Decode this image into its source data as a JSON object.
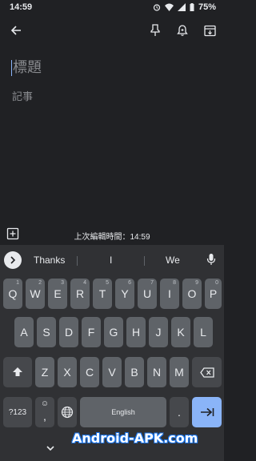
{
  "status_bar": {
    "time": "14:59",
    "battery": "75%"
  },
  "icons": {
    "back": "back-arrow-icon",
    "pin": "pin-icon",
    "reminder": "reminder-bell-icon",
    "archive": "archive-icon",
    "add_box": "add-box-icon",
    "expand": "chevron-right-icon",
    "mic": "mic-icon",
    "shift": "shift-icon",
    "backspace": "backspace-icon",
    "globe": "globe-icon",
    "enter": "enter-arrow-icon"
  },
  "note": {
    "title_placeholder": "標題",
    "body_placeholder": "記事",
    "edited_label": "上次編輯時間：14:59"
  },
  "keyboard": {
    "suggestions": [
      "Thanks",
      "I",
      "We"
    ],
    "row1": [
      {
        "label": "Q",
        "hint": "1"
      },
      {
        "label": "W",
        "hint": "2"
      },
      {
        "label": "E",
        "hint": "3"
      },
      {
        "label": "R",
        "hint": "4"
      },
      {
        "label": "T",
        "hint": "5"
      },
      {
        "label": "Y",
        "hint": "6"
      },
      {
        "label": "U",
        "hint": "7"
      },
      {
        "label": "I",
        "hint": "8"
      },
      {
        "label": "O",
        "hint": "9"
      },
      {
        "label": "P",
        "hint": "0"
      }
    ],
    "row2": [
      "A",
      "S",
      "D",
      "F",
      "G",
      "H",
      "J",
      "K",
      "L"
    ],
    "row3": [
      "Z",
      "X",
      "C",
      "V",
      "B",
      "N",
      "M"
    ],
    "symbols_label": "?123",
    "emoji_label": "☺",
    "comma_label": ",",
    "space_label": "English",
    "period_label": "."
  },
  "watermark": "Android-APK.com",
  "colors": {
    "background": "#202124",
    "keyboard": "#303134",
    "key": "#5f6368",
    "accent": "#8ab4f8"
  }
}
